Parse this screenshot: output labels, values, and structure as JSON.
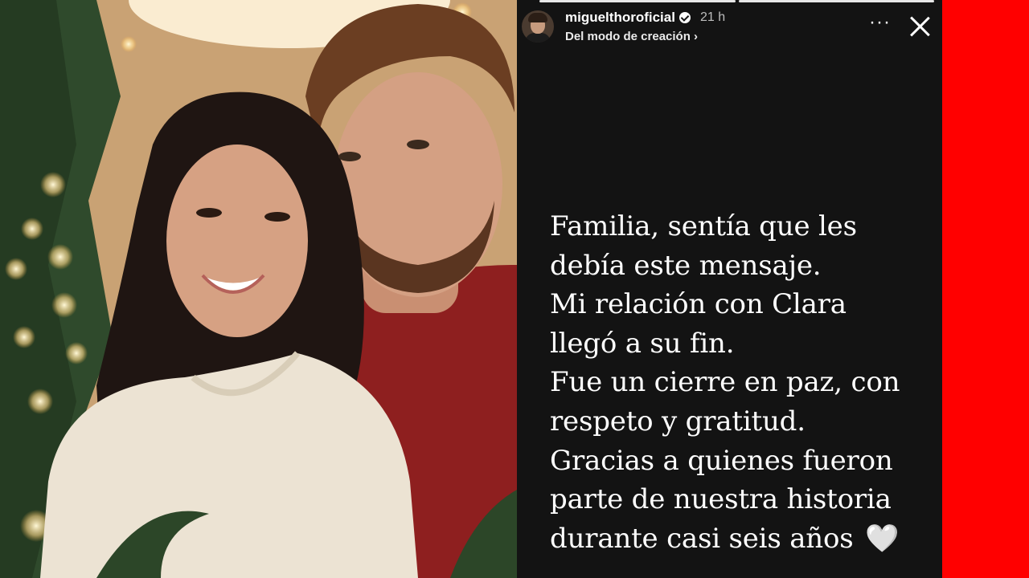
{
  "story": {
    "username": "miguelthoroficial",
    "verified": true,
    "time_ago": "21 h",
    "source_label": "Del modo de creación",
    "source_chevron": "›",
    "more_icon": "···",
    "progress": {
      "segments": 2,
      "active_segment": 2
    },
    "message_lines": [
      "Familia, sentía que les",
      "debía este mensaje.",
      "Mi relación con Clara",
      "llegó a su fin.",
      "Fue un cierre en paz, con",
      "respeto y gratitud.",
      "Gracias a quienes fueron",
      "parte de nuestra historia",
      "durante casi seis años"
    ],
    "heart_emoji": "🤍"
  },
  "colors": {
    "story_background": "#131313",
    "side_bar": "#ff0000",
    "text": "#ffffff"
  },
  "icons": [
    "verified-badge-icon",
    "more-options-icon",
    "close-icon",
    "white-heart-icon"
  ]
}
